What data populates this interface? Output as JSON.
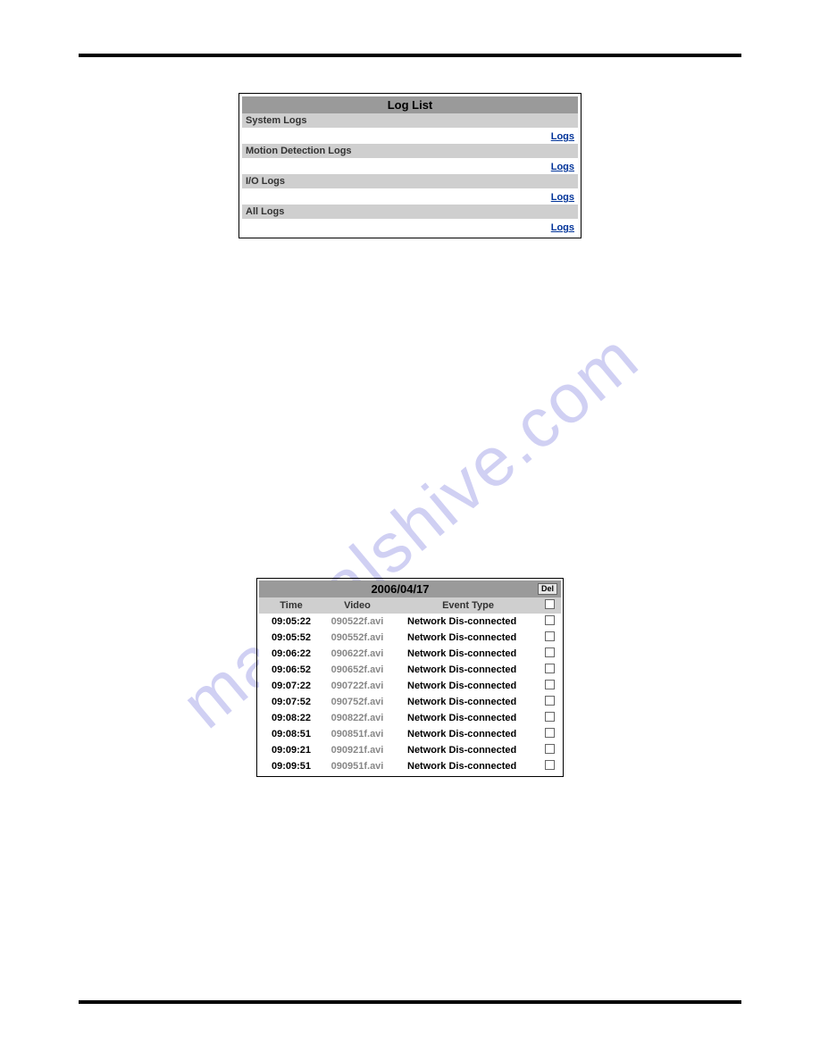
{
  "watermark": "manualshive.com",
  "loglist": {
    "title": "Log List",
    "sections": [
      {
        "label": "System Logs",
        "link": "Logs"
      },
      {
        "label": "Motion Detection Logs",
        "link": "Logs"
      },
      {
        "label": "I/O Logs",
        "link": "Logs"
      },
      {
        "label": "All Logs",
        "link": "Logs"
      }
    ]
  },
  "logtable": {
    "date": "2006/04/17",
    "del": "Del",
    "headers": {
      "time": "Time",
      "video": "Video",
      "event": "Event Type"
    },
    "rows": [
      {
        "time": "09:05:22",
        "video": "090522f.avi",
        "event": "Network Dis-connected"
      },
      {
        "time": "09:05:52",
        "video": "090552f.avi",
        "event": "Network Dis-connected"
      },
      {
        "time": "09:06:22",
        "video": "090622f.avi",
        "event": "Network Dis-connected"
      },
      {
        "time": "09:06:52",
        "video": "090652f.avi",
        "event": "Network Dis-connected"
      },
      {
        "time": "09:07:22",
        "video": "090722f.avi",
        "event": "Network Dis-connected"
      },
      {
        "time": "09:07:52",
        "video": "090752f.avi",
        "event": "Network Dis-connected"
      },
      {
        "time": "09:08:22",
        "video": "090822f.avi",
        "event": "Network Dis-connected"
      },
      {
        "time": "09:08:51",
        "video": "090851f.avi",
        "event": "Network Dis-connected"
      },
      {
        "time": "09:09:21",
        "video": "090921f.avi",
        "event": "Network Dis-connected"
      },
      {
        "time": "09:09:51",
        "video": "090951f.avi",
        "event": "Network Dis-connected"
      }
    ]
  }
}
